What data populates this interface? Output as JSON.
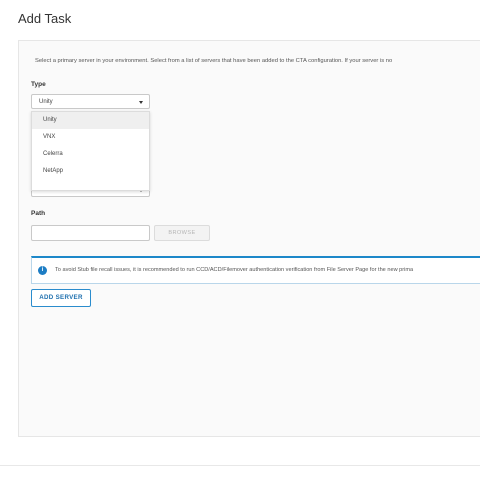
{
  "page": {
    "title": "Add Task"
  },
  "form": {
    "intro": "Select a primary server in your environment. Select from a list of servers that have been added to the CTA configuration. If your server is no",
    "type_label": "Type",
    "type_value": "Unity",
    "type_options": [
      "Unity",
      "VNX",
      "Celerra",
      "NetApp"
    ],
    "path_label": "Path",
    "path_value": "",
    "browse_label": "BROWSE"
  },
  "info": {
    "icon": "info-icon",
    "text": "To avoid Stub file recall issues, it is recommended to run CCD/ACD/Filemover authentication verification from File Server Page for the new prima"
  },
  "actions": {
    "add_server_label": "ADD SERVER"
  },
  "colors": {
    "accent": "#1d7dc4",
    "border": "#c9c9c9"
  }
}
